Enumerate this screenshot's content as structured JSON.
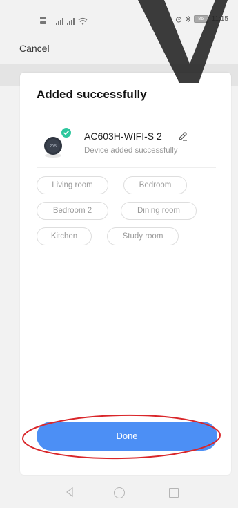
{
  "status_bar": {
    "time": "11:15",
    "battery": "86"
  },
  "header": {
    "cancel_label": "Cancel"
  },
  "card": {
    "title": "Added successfully",
    "device": {
      "name": "AC603H-WIFI-S 2",
      "status": "Device added successfully",
      "thermostat_reading": "20.5"
    },
    "rooms": [
      "Living room",
      "Bedroom",
      "Bedroom 2",
      "Dining room",
      "Kitchen",
      "Study room"
    ],
    "done_label": "Done"
  },
  "colors": {
    "accent": "#4c8ff5",
    "success": "#2ec79e",
    "annotation": "#d9262a",
    "watermark": "#222222"
  }
}
